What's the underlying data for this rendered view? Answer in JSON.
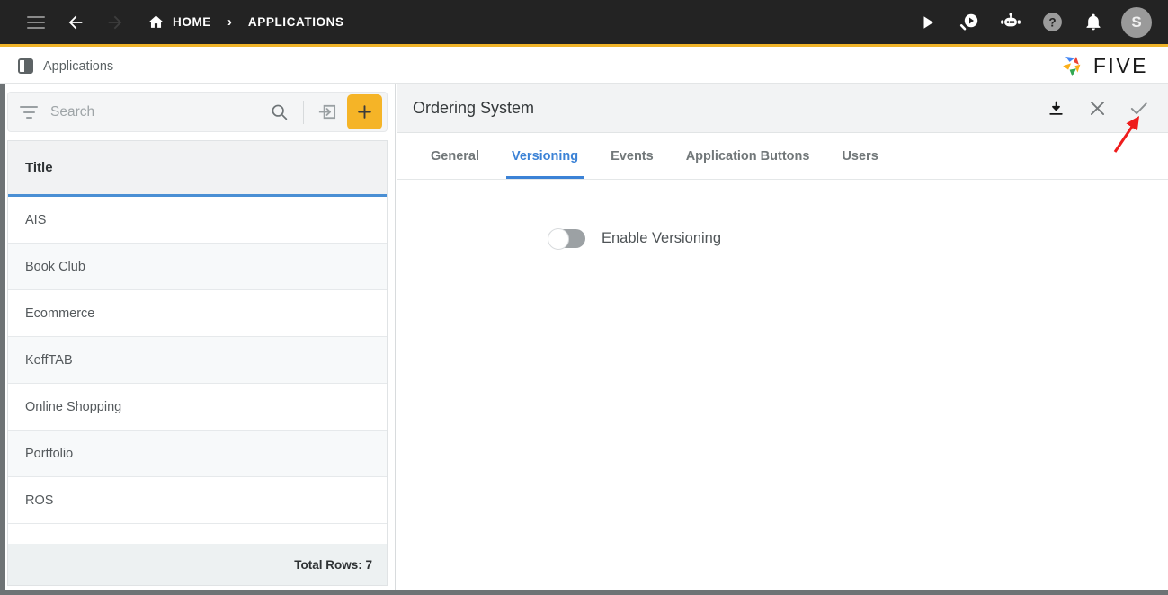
{
  "topbar": {
    "menu_icon": "hamburger-icon",
    "back_icon": "arrow-back-icon",
    "forward_icon": "arrow-forward-icon",
    "home_icon": "home-icon",
    "home_label": "HOME",
    "separator": "›",
    "breadcrumb_label": "APPLICATIONS",
    "run_icon": "play-icon",
    "search_chat_icon": "search-play-icon",
    "bot_icon": "robot-icon",
    "help_icon": "question-mark-icon",
    "notifications_icon": "bell-icon",
    "avatar_initial": "S",
    "background": "#232323",
    "accent_underline": "#F0B429"
  },
  "appstrip": {
    "tab_icon": "panel-split-icon",
    "tab_label": "Applications",
    "brand_text": "FIVE",
    "brand_icon": "five-pinwheel-logo"
  },
  "left_panel": {
    "search": {
      "filter_icon": "filter-icon",
      "placeholder": "Search",
      "value": "",
      "search_icon": "magnifier-icon",
      "import_icon": "import-arrow-icon",
      "add_icon": "plus-icon",
      "add_button_color": "#F5B427"
    },
    "grid": {
      "columns": [
        "Title"
      ],
      "header_underline_color": "#4a8fd4",
      "rows": [
        {
          "title": "AIS"
        },
        {
          "title": "Book Club"
        },
        {
          "title": "Ecommerce"
        },
        {
          "title": "KeffTAB"
        },
        {
          "title": "Online Shopping"
        },
        {
          "title": "Portfolio"
        },
        {
          "title": "ROS"
        }
      ],
      "footer_text": "Total Rows: 7"
    }
  },
  "right_panel": {
    "title": "Ordering System",
    "actions": {
      "download_icon": "download-icon",
      "close_icon": "close-x-icon",
      "save_icon": "checkmark-icon"
    },
    "tabs": [
      {
        "label": "General",
        "active": false
      },
      {
        "label": "Versioning",
        "active": true
      },
      {
        "label": "Events",
        "active": false
      },
      {
        "label": "Application Buttons",
        "active": false
      },
      {
        "label": "Users",
        "active": false
      }
    ],
    "active_tab_color": "#3b82d6",
    "form": {
      "versioning_toggle": {
        "label": "Enable Versioning",
        "state": "off"
      }
    }
  },
  "annotation": {
    "arrow_color": "#EE1C1C",
    "points_to": "checkmark-icon"
  }
}
